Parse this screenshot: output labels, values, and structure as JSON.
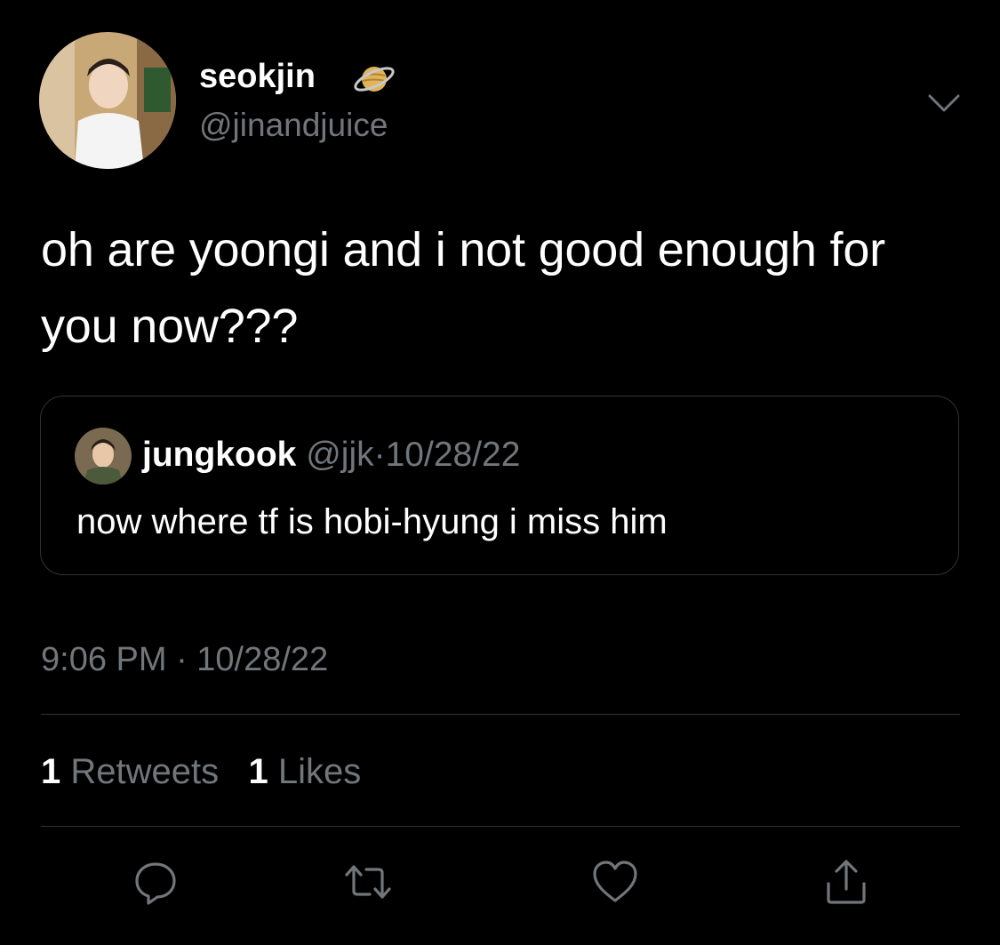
{
  "author": {
    "display_name": "seokjin",
    "handle": "@jinandjuice",
    "badge_icon": "planet-icon",
    "avatar_icon": "avatar-photo"
  },
  "tweet": {
    "text": "oh are yoongi and i not good enough for you now???",
    "timestamp": "9:06 PM · 10/28/22"
  },
  "quoted_tweet": {
    "display_name": "jungkook",
    "handle": "@jjk",
    "separator": "·",
    "date": "10/28/22",
    "text": "now where tf is hobi-hyung i miss him"
  },
  "stats": {
    "retweets_count": "1",
    "retweets_label": "Retweets",
    "likes_count": "1",
    "likes_label": "Likes"
  },
  "actions": [
    {
      "name": "reply",
      "icon": "reply-icon"
    },
    {
      "name": "retweet",
      "icon": "retweet-icon"
    },
    {
      "name": "like",
      "icon": "heart-icon"
    },
    {
      "name": "share",
      "icon": "share-icon"
    }
  ],
  "colors": {
    "background": "#000000",
    "text_primary": "#ffffff",
    "text_secondary": "#71767b",
    "border": "#2f3336",
    "icon": "#71767b"
  }
}
